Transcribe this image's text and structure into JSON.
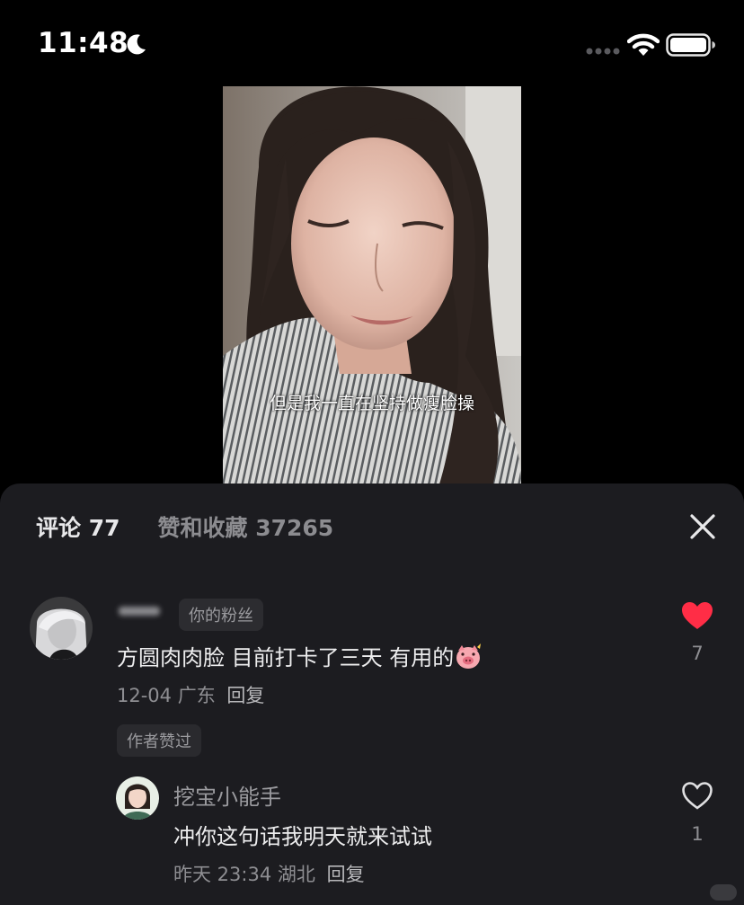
{
  "status_bar": {
    "time": "11:48",
    "moon_icon": "moon-icon",
    "signal_icon": "signal-icon",
    "wifi_icon": "wifi-icon",
    "battery_icon": "battery-icon"
  },
  "video": {
    "caption": "但是我一直在坚持做瘦脸操"
  },
  "panel": {
    "tab_comments": "评论 77",
    "tab_likes": "赞和收藏 37265",
    "close_icon": "close-icon"
  },
  "comments": [
    {
      "badge": "你的粉丝",
      "text": "方圆肉肉脸  目前打卡了三天 有用的",
      "emoji": "pig-face-emoji",
      "date": "12-04",
      "location": "广东",
      "reply_label": "回复",
      "author_liked": "作者赞过",
      "likes": "7",
      "liked": true,
      "like_color": "#ff2d46"
    },
    {
      "username": "挖宝小能手",
      "text": "冲你这句话我明天就来试试",
      "date": "昨天 23:34",
      "location": "湖北",
      "reply_label": "回复",
      "likes": "1",
      "liked": false
    }
  ]
}
